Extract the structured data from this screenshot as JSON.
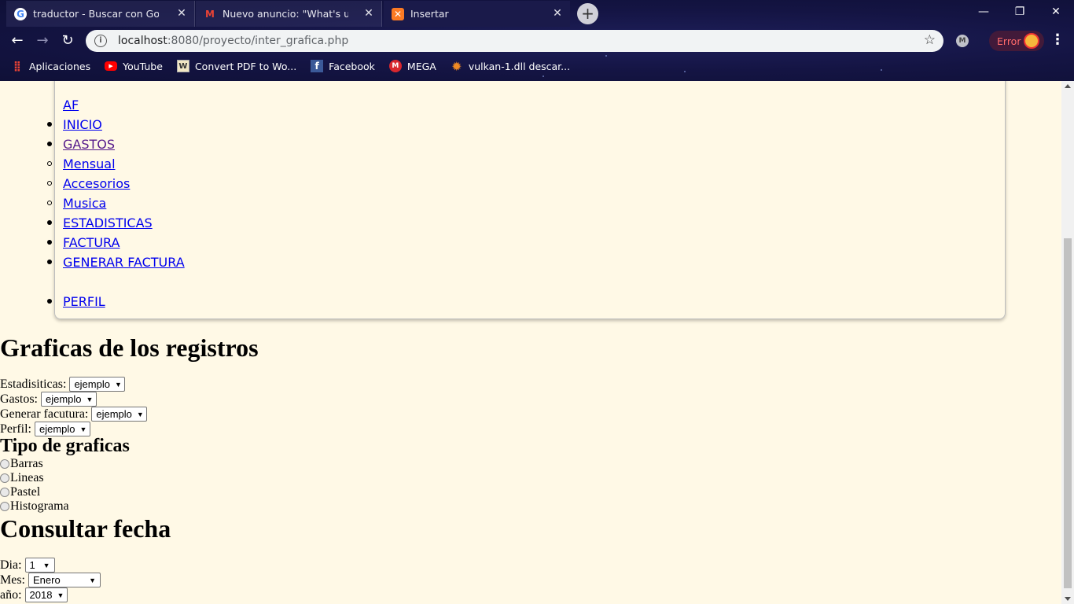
{
  "browser": {
    "tabs": [
      {
        "title": "traductor - Buscar con Google",
        "icon": "google-icon",
        "active": false
      },
      {
        "title": "Nuevo anuncio: \"What's up chava",
        "icon": "gmail-icon",
        "active": false
      },
      {
        "title": "Insertar",
        "icon": "xampp-icon",
        "active": true
      }
    ],
    "url_host": "localhost",
    "url_path": ":8080/proyecto/inter_grafica.php",
    "error_label": "Error",
    "bookmarks": [
      {
        "label": "Aplicaciones",
        "icon": "apps-grid-icon"
      },
      {
        "label": "YouTube",
        "icon": "youtube-icon"
      },
      {
        "label": "Convert PDF to Wo...",
        "icon": "pdf-convert-icon"
      },
      {
        "label": "Facebook",
        "icon": "facebook-icon"
      },
      {
        "label": "MEGA",
        "icon": "mega-icon"
      },
      {
        "label": "vulkan-1.dll descar...",
        "icon": "gear-orange-icon"
      }
    ]
  },
  "nav": {
    "brand": "AF",
    "items": [
      {
        "label": "INICIO",
        "bullet": "disc"
      },
      {
        "label": "GASTOS",
        "bullet": "disc",
        "visited": true
      },
      {
        "label": "Mensual",
        "bullet": "circle"
      },
      {
        "label": "Accesorios",
        "bullet": "circle"
      },
      {
        "label": "Musica",
        "bullet": "circle"
      },
      {
        "label": "ESTADISTICAS",
        "bullet": "disc"
      },
      {
        "label": "FACTURA",
        "bullet": "disc"
      },
      {
        "label": "GENERAR FACTURA",
        "bullet": "disc"
      },
      {
        "label": "PERFIL",
        "bullet": "disc"
      }
    ]
  },
  "main": {
    "heading": "Graficas de los registros",
    "selects": [
      {
        "label": "Estadisiticas:",
        "value": "ejemplo"
      },
      {
        "label": "Gastos:",
        "value": "ejemplo"
      },
      {
        "label": "Generar facutura:",
        "value": "ejemplo"
      },
      {
        "label": "Perfil:",
        "value": "ejemplo"
      }
    ],
    "chart_type_heading": "Tipo de graficas",
    "chart_types": [
      "Barras",
      "Lineas",
      "Pastel",
      "Histograma"
    ],
    "date_heading": "Consultar fecha",
    "date_fields": [
      {
        "label": "Dia:",
        "value": "1"
      },
      {
        "label": "Mes:",
        "value": "Enero"
      },
      {
        "label": "año:",
        "value": "2018"
      }
    ]
  }
}
